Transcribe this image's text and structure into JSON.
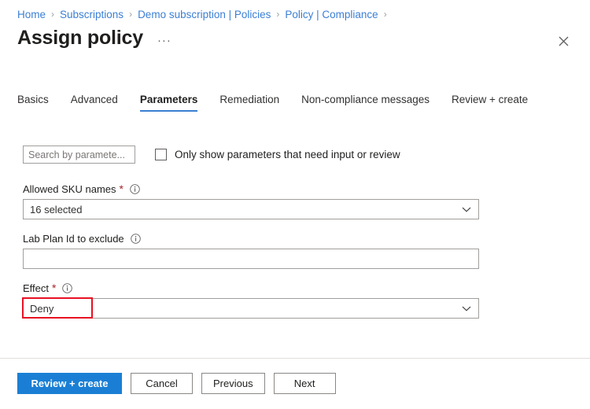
{
  "breadcrumb": {
    "separator": "›",
    "items": [
      {
        "label": "Home"
      },
      {
        "label": "Subscriptions"
      },
      {
        "label": "Demo subscription | Policies"
      },
      {
        "label": "Policy | Compliance"
      }
    ]
  },
  "header": {
    "title": "Assign policy",
    "more_menu": "···",
    "close_icon": "close-icon"
  },
  "tabs": [
    {
      "label": "Basics",
      "active": false
    },
    {
      "label": "Advanced",
      "active": false
    },
    {
      "label": "Parameters",
      "active": true
    },
    {
      "label": "Remediation",
      "active": false
    },
    {
      "label": "Non-compliance messages",
      "active": false
    },
    {
      "label": "Review + create",
      "active": false
    }
  ],
  "filters": {
    "search_placeholder": "Search by paramete...",
    "search_value": "",
    "checkbox_label": "Only show parameters that need input or review",
    "checkbox_checked": false
  },
  "fields": [
    {
      "label": "Allowed SKU names",
      "required": true,
      "info": true,
      "type": "dropdown",
      "value": "16 selected"
    },
    {
      "label": "Lab Plan Id to exclude",
      "required": false,
      "info": true,
      "type": "text",
      "value": ""
    },
    {
      "label": "Effect",
      "required": true,
      "info": true,
      "type": "dropdown",
      "value": "Deny"
    }
  ],
  "annotation": {
    "color": "#e81123",
    "target": "effect-dropdown-value"
  },
  "footer": {
    "review_create": "Review + create",
    "cancel": "Cancel",
    "previous": "Previous",
    "next": "Next"
  },
  "colors": {
    "accent": "#1a7fd4",
    "link": "#3b7fd4",
    "required": "#a4262c",
    "annotation": "#e81123"
  }
}
